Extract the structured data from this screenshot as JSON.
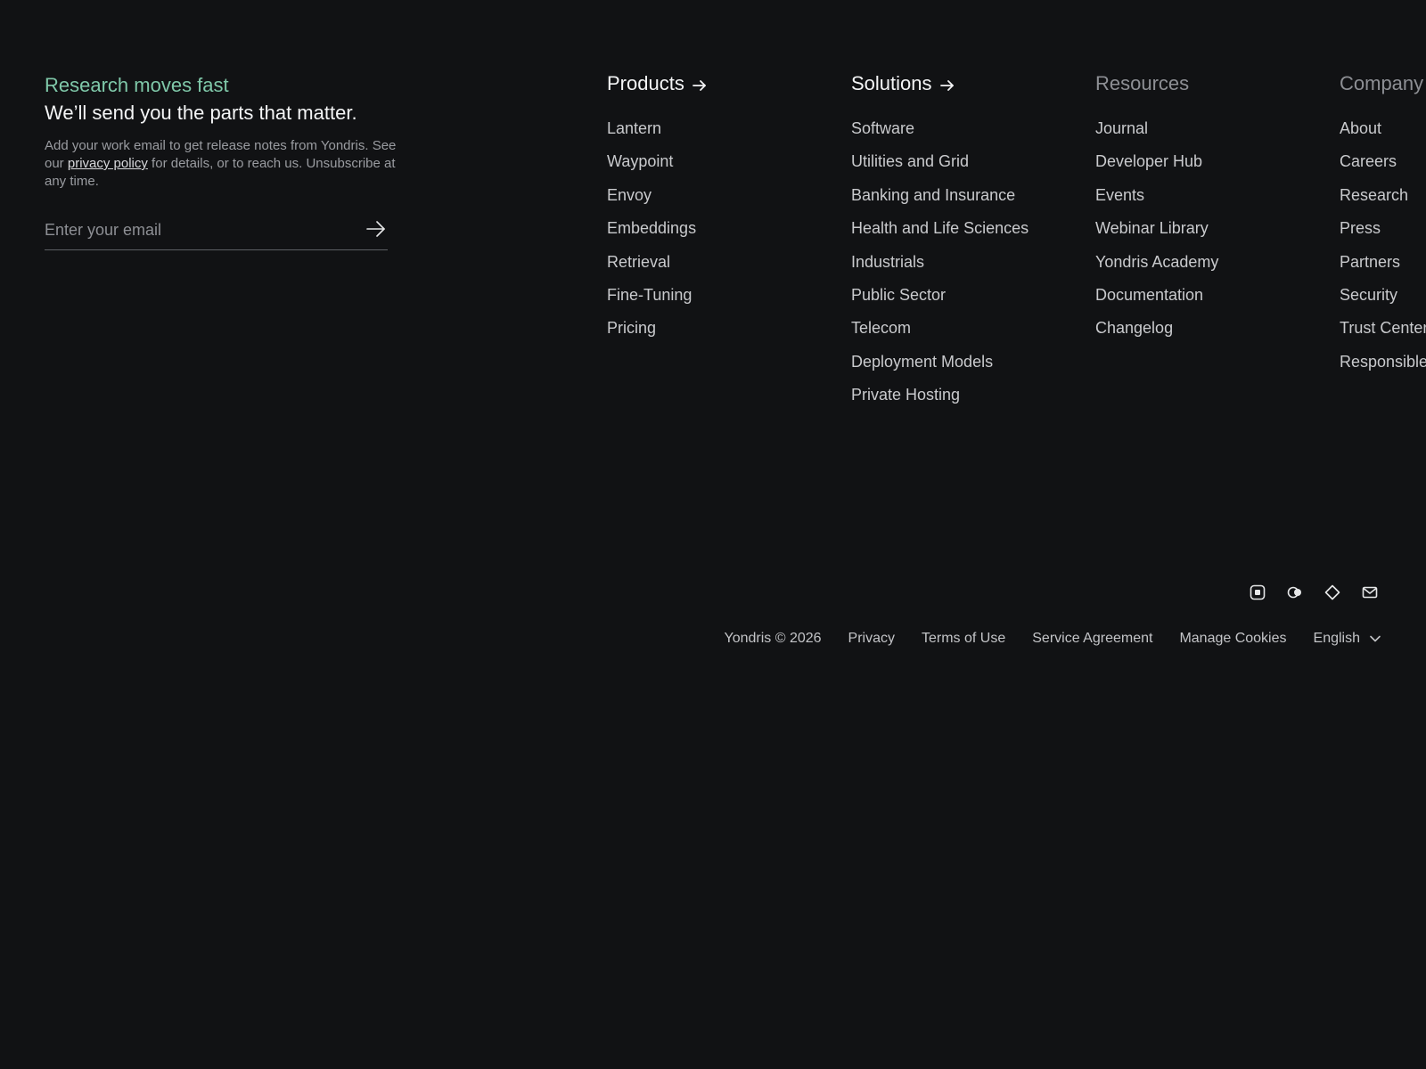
{
  "newsletter": {
    "eyebrow": "Research moves fast",
    "headline": "We’ll send you the parts that matter.",
    "desc_before": "Add your work email to get release notes from Yondris. See our ",
    "privacy_link": "privacy policy",
    "desc_after": " for details, or to reach us. Unsubscribe at any time.",
    "email_placeholder": "Enter your email",
    "submit_icon": "arrow-right-icon"
  },
  "columns": {
    "products": {
      "heading": "Products",
      "items": [
        "Lantern",
        "Waypoint",
        "Envoy",
        "Embeddings",
        "Retrieval",
        "Fine-Tuning",
        "Pricing"
      ]
    },
    "solutions": {
      "heading": "Solutions",
      "items": [
        "Software",
        "Utilities and Grid",
        "Banking and Insurance",
        "Health and Life Sciences",
        "Industrials",
        "Public Sector",
        "Telecom",
        "Deployment Models",
        "Private Hosting"
      ]
    },
    "resources": {
      "heading": "Resources",
      "items": [
        "Journal",
        "Developer Hub",
        "Events",
        "Webinar Library",
        "Yondris Academy",
        "Documentation",
        "Changelog"
      ]
    },
    "company": {
      "heading": "Company",
      "items": [
        "About",
        "Careers",
        "Research",
        "Press",
        "Partners",
        "Security",
        "Trust Center",
        "Responsible"
      ]
    }
  },
  "social_icons": [
    "instagram-icon",
    "toggle-icon",
    "diamond-icon",
    "mail-icon"
  ],
  "legal": {
    "copyright": "Yondris © 2026",
    "privacy": "Privacy",
    "terms": "Terms of Use",
    "service": "Service Agreement",
    "cookies": "Manage Cookies",
    "language": "English"
  },
  "colors": {
    "background": "#111214",
    "accent": "#7fc8a9",
    "text_primary": "#f4f5f6",
    "text_muted": "#8d8f94"
  }
}
